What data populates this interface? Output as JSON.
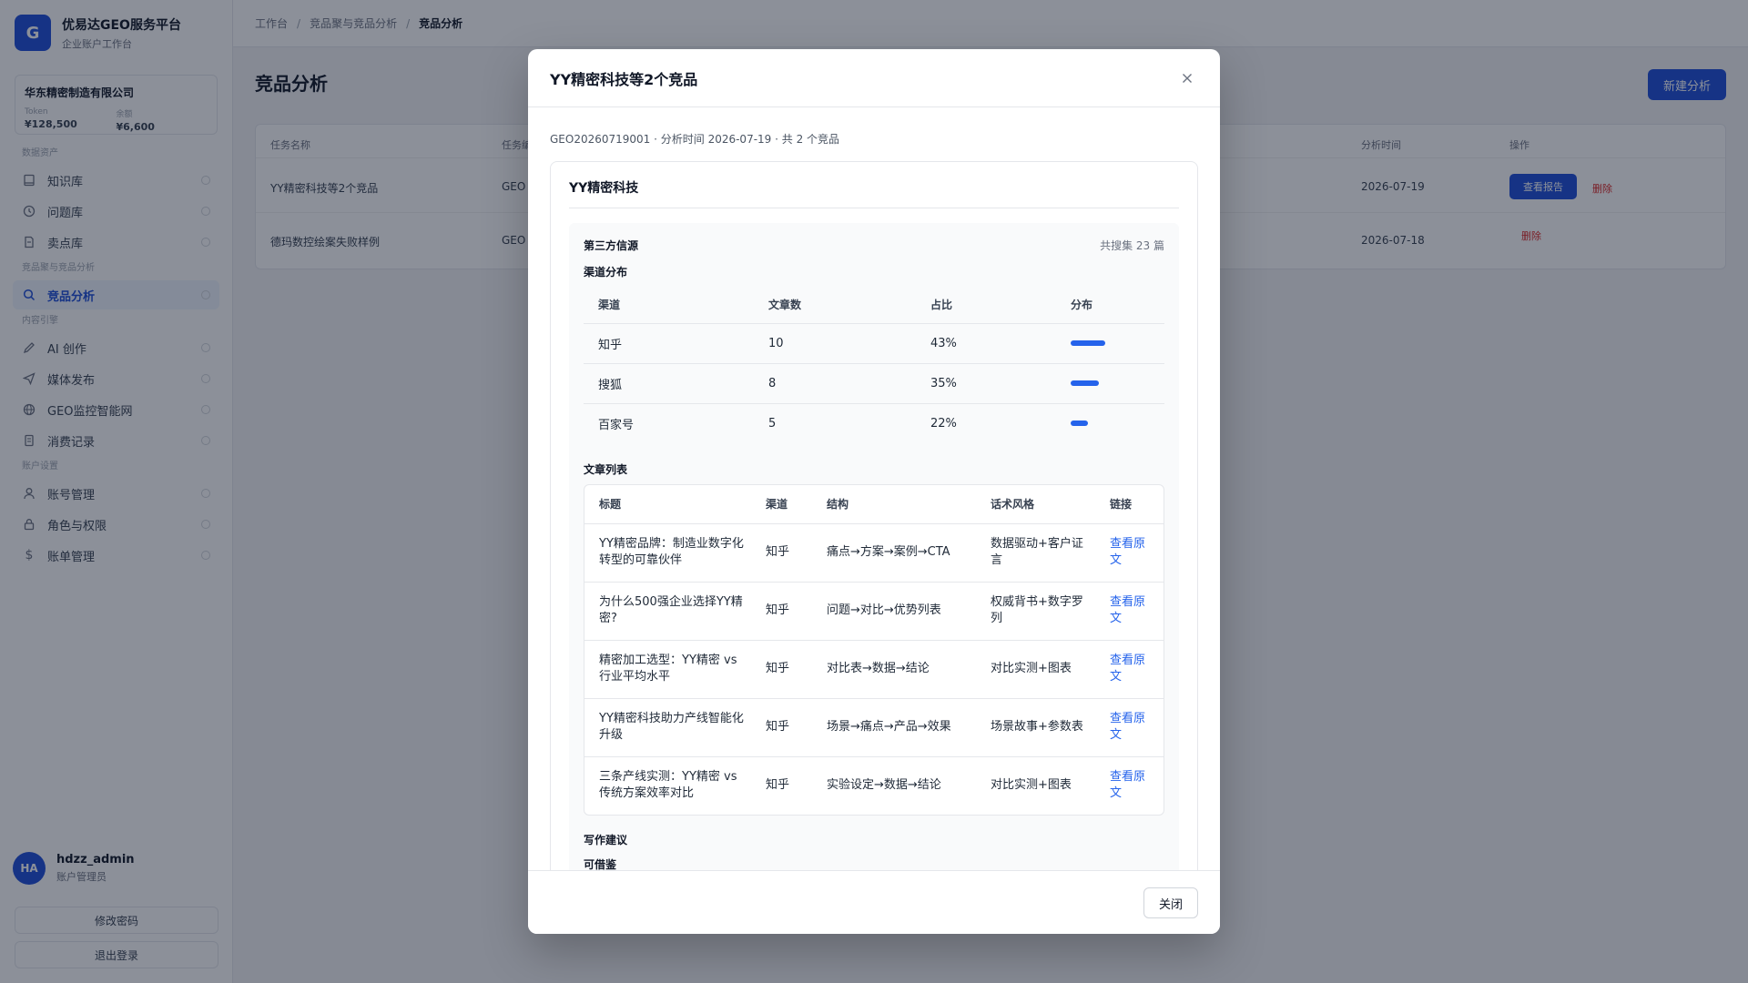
{
  "brand": {
    "logo": "G",
    "title": "优易达GEO服务平台",
    "subtitle": "企业账户工作台"
  },
  "company": {
    "name": "华东精密制造有限公司",
    "stats": [
      {
        "label": "Token",
        "value": "¥128,500"
      },
      {
        "label": "余额",
        "value": "¥6,600"
      }
    ]
  },
  "nav": {
    "sections": [
      "数据资产",
      "竞品聚与竞品分析",
      "内容引擎",
      "账户设置"
    ],
    "items": [
      {
        "label": "知识库",
        "icon": "book-icon"
      },
      {
        "label": "问题库",
        "icon": "clock-icon"
      },
      {
        "label": "卖点库",
        "icon": "document-icon"
      },
      {
        "label": "竞品分析",
        "icon": "search-icon"
      },
      {
        "label": "AI 创作",
        "icon": "pen-icon"
      },
      {
        "label": "媒体发布",
        "icon": "send-icon"
      },
      {
        "label": "GEO监控智能网",
        "icon": "globe-icon"
      },
      {
        "label": "消费记录",
        "icon": "receipt-icon"
      },
      {
        "label": "账号管理",
        "icon": "user-icon"
      },
      {
        "label": "角色与权限",
        "icon": "lock-icon"
      },
      {
        "label": "账单管理",
        "icon": "dollar-icon"
      }
    ]
  },
  "user": {
    "initials": "HA",
    "name": "hdzz_admin",
    "role": "账户管理员",
    "change_password": "修改密码",
    "logout": "退出登录"
  },
  "breadcrumb": [
    "工作台",
    "竞品聚与竞品分析",
    "竞品分析"
  ],
  "page": {
    "title": "竞品分析",
    "new_button": "新建分析"
  },
  "bg_table": {
    "headers": [
      "任务名称",
      "任务编号",
      "分析时间",
      "操作"
    ],
    "rows": [
      {
        "name": "YY精密科技等2个竞品",
        "code": "GEO",
        "date": "2026-07-19",
        "view": "查看报告",
        "delete": "删除"
      },
      {
        "name": "德玛数控绘案失败样例",
        "code": "GEO",
        "date": "2026-07-18",
        "delete": "删除"
      }
    ]
  },
  "modal": {
    "title": "YY精密科技等2个竞品",
    "meta": "GEO20260719001 · 分析时间 2026-07-19 · 共 2 个竞品",
    "competitor": "YY精密科技",
    "source_title": "第三方信源",
    "source_count": "共搜集 23 篇",
    "channel_title": "渠道分布",
    "channel_headers": [
      "渠道",
      "文章数",
      "占比",
      "分布"
    ],
    "channels": [
      {
        "name": "知乎",
        "count": "10",
        "pct": "43%",
        "share": 0.43
      },
      {
        "name": "搜狐",
        "count": "8",
        "pct": "35%",
        "share": 0.35
      },
      {
        "name": "百家号",
        "count": "5",
        "pct": "22%",
        "share": 0.22
      }
    ],
    "article_title": "文章列表",
    "article_headers": [
      "标题",
      "渠道",
      "结构",
      "话术风格",
      "链接"
    ],
    "articles": [
      {
        "title": "YY精密品牌：制造业数字化转型的可靠伙伴",
        "channel": "知乎",
        "structure": "痛点→方案→案例→CTA",
        "style": "数据驱动+客户证言",
        "link": "查看原文"
      },
      {
        "title": "为什么500强企业选择YY精密?",
        "channel": "知乎",
        "structure": "问题→对比→优势列表",
        "style": "权威背书+数字罗列",
        "link": "查看原文"
      },
      {
        "title": "精密加工选型：YY精密 vs 行业平均水平",
        "channel": "知乎",
        "structure": "对比表→数据→结论",
        "style": "对比实测+图表",
        "link": "查看原文"
      },
      {
        "title": "YY精密科技助力产线智能化升级",
        "channel": "知乎",
        "structure": "场景→痛点→产品→效果",
        "style": "场景故事+参数表",
        "link": "查看原文"
      },
      {
        "title": "三条产线实测：YY精密 vs 传统方案效率对比",
        "channel": "知乎",
        "structure": "实验设定→数据→结论",
        "style": "对比实测+图表",
        "link": "查看原文"
      }
    ],
    "suggest_title": "写作建议",
    "borrow_title": "可借鉴",
    "close_label": "关闭"
  },
  "colors": {
    "accent": "#2563eb",
    "brand": "#1d4ed8",
    "danger": "#dc2626"
  }
}
